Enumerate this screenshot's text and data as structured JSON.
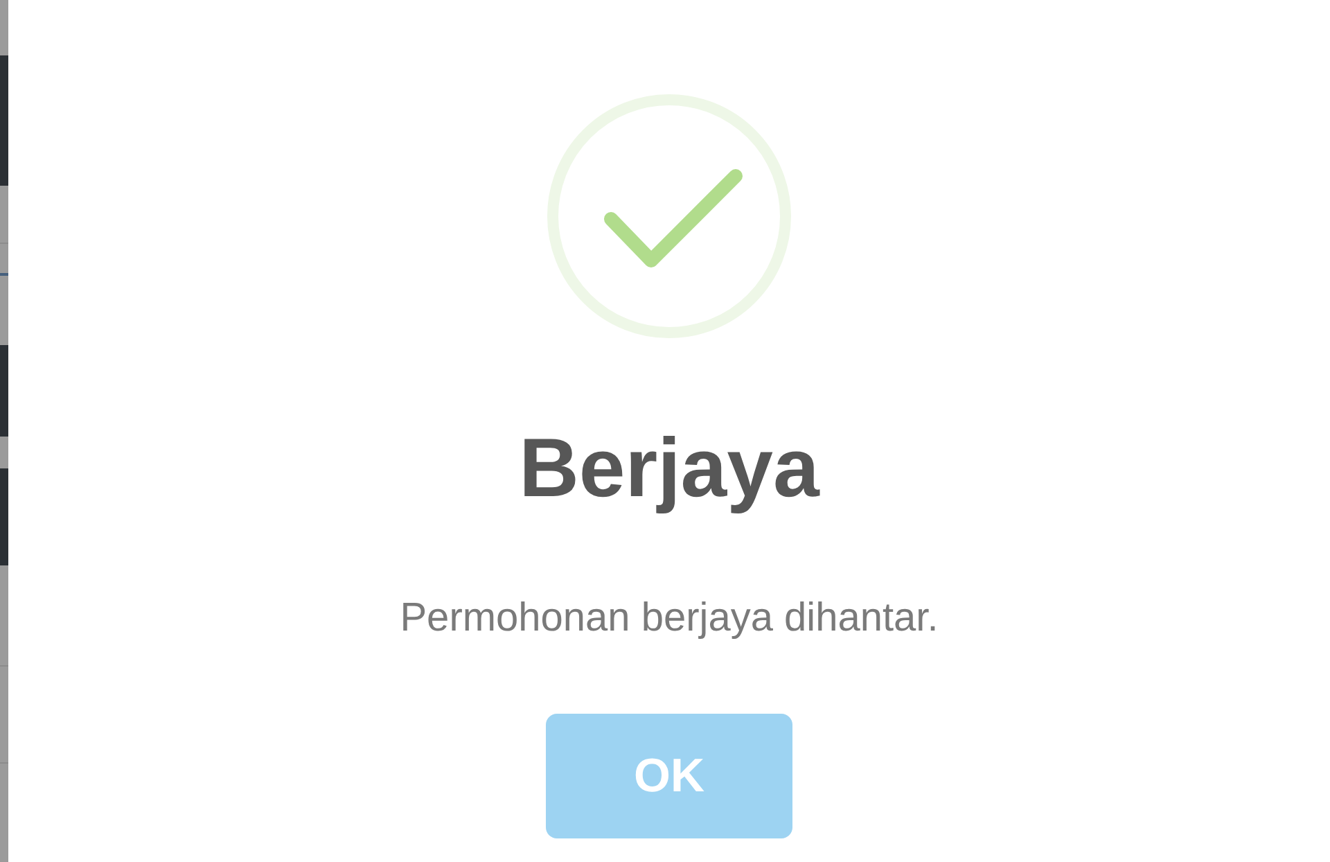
{
  "dialog": {
    "icon": {
      "kind": "success"
    },
    "title": "Berjaya",
    "message": "Permohonan berjaya dihantar.",
    "button": {
      "label": "OK"
    }
  }
}
